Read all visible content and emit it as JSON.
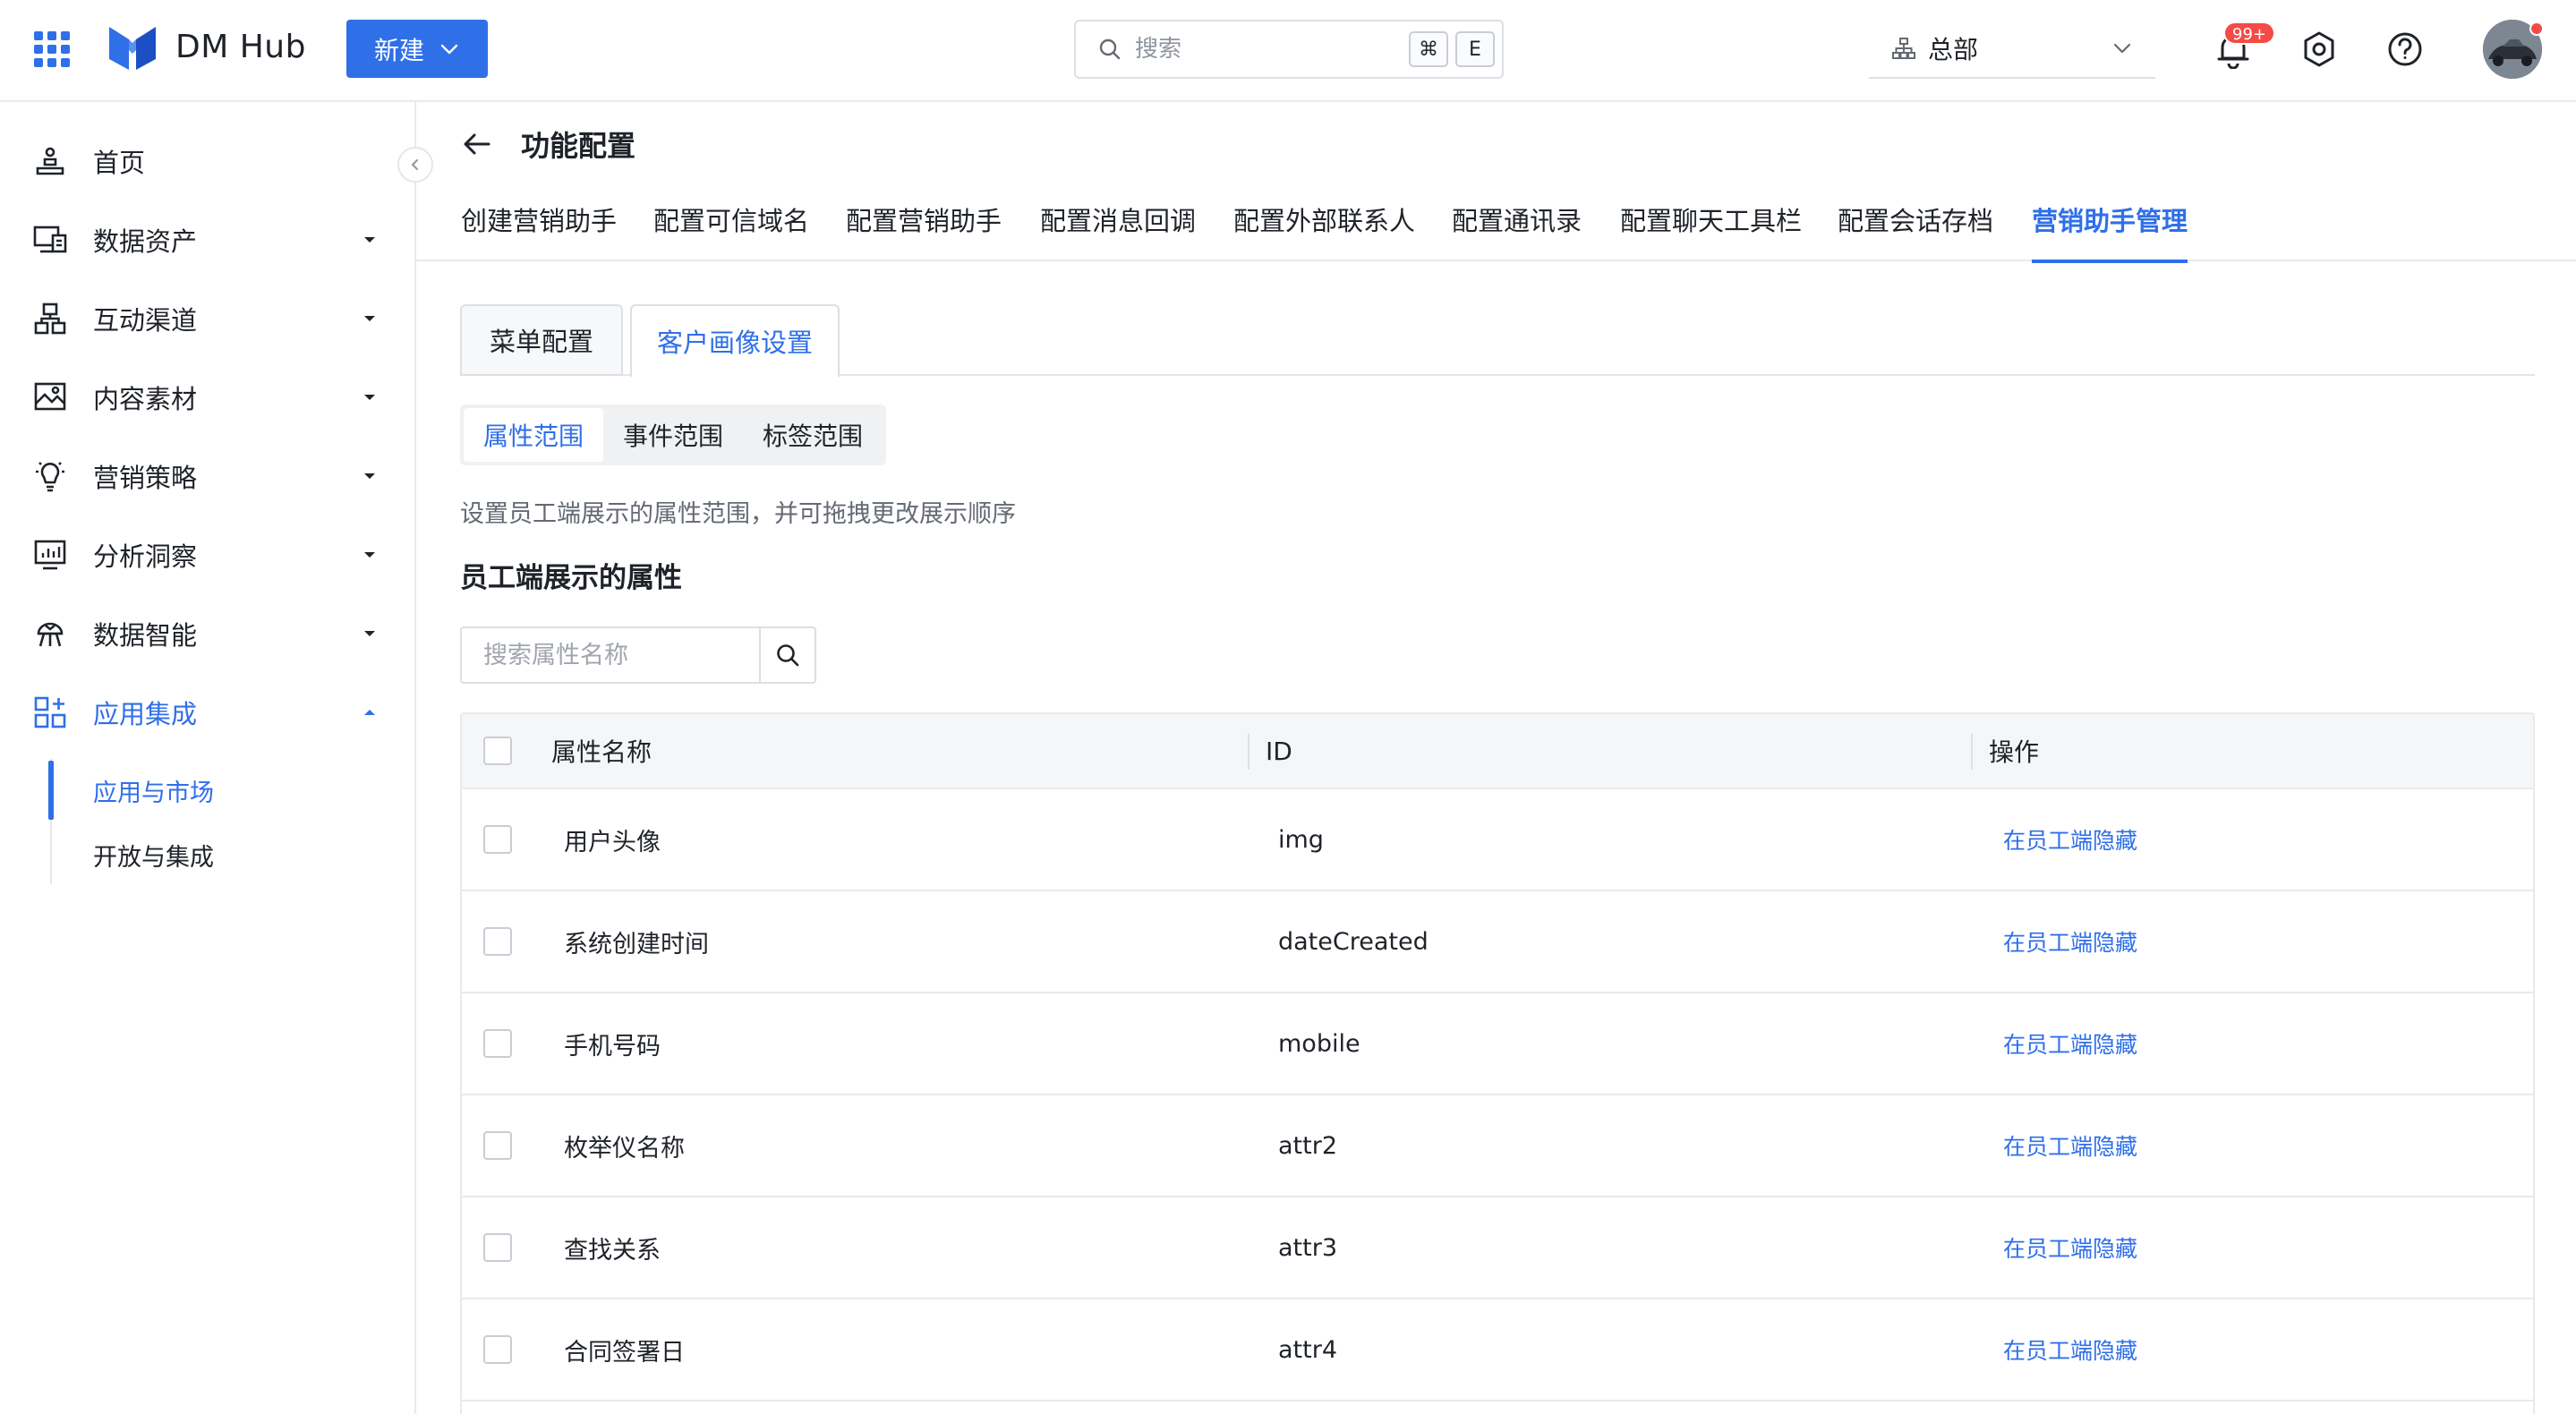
{
  "brand": {
    "name": "DM Hub",
    "accent": "#2f6fe8"
  },
  "toolbar": {
    "new_label": "新建",
    "search_placeholder": "搜索",
    "shortcut_key1": "⌘",
    "shortcut_key2": "E",
    "org_label": "总部",
    "notification_badge": "99+"
  },
  "sidebar": {
    "items": [
      {
        "label": "首页",
        "icon": "home-icon"
      },
      {
        "label": "数据资产",
        "icon": "data-asset-icon"
      },
      {
        "label": "互动渠道",
        "icon": "channel-icon"
      },
      {
        "label": "内容素材",
        "icon": "image-icon"
      },
      {
        "label": "营销策略",
        "icon": "lightbulb-icon"
      },
      {
        "label": "分析洞察",
        "icon": "analysis-icon"
      },
      {
        "label": "数据智能",
        "icon": "brain-icon"
      },
      {
        "label": "应用集成",
        "icon": "apps-grid-icon"
      }
    ],
    "sub_items": [
      {
        "label": "应用与市场"
      },
      {
        "label": "开放与集成"
      }
    ]
  },
  "page": {
    "title": "功能配置",
    "func_tabs": [
      "创建营销助手",
      "配置可信域名",
      "配置营销助手",
      "配置消息回调",
      "配置外部联系人",
      "配置通讯录",
      "配置聊天工具栏",
      "配置会话存档",
      "营销助手管理"
    ],
    "card_tabs": [
      "菜单配置",
      "客户画像设置"
    ],
    "seg_tabs": [
      "属性范围",
      "事件范围",
      "标签范围"
    ],
    "description": "设置员工端展示的属性范围，并可拖拽更改展示顺序",
    "section_title": "员工端展示的属性",
    "attr_search_placeholder": "搜索属性名称"
  },
  "table": {
    "columns": [
      "属性名称",
      "ID",
      "操作"
    ],
    "rows": [
      {
        "name": "用户头像",
        "id": "img",
        "action": "在员工端隐藏"
      },
      {
        "name": "系统创建时间",
        "id": "dateCreated",
        "action": "在员工端隐藏"
      },
      {
        "name": "手机号码",
        "id": "mobile",
        "action": "在员工端隐藏"
      },
      {
        "name": "枚举仪名称",
        "id": "attr2",
        "action": "在员工端隐藏"
      },
      {
        "name": "查找关系",
        "id": "attr3",
        "action": "在员工端隐藏"
      },
      {
        "name": "合同签署日",
        "id": "attr4",
        "action": "在员工端隐藏"
      }
    ]
  }
}
